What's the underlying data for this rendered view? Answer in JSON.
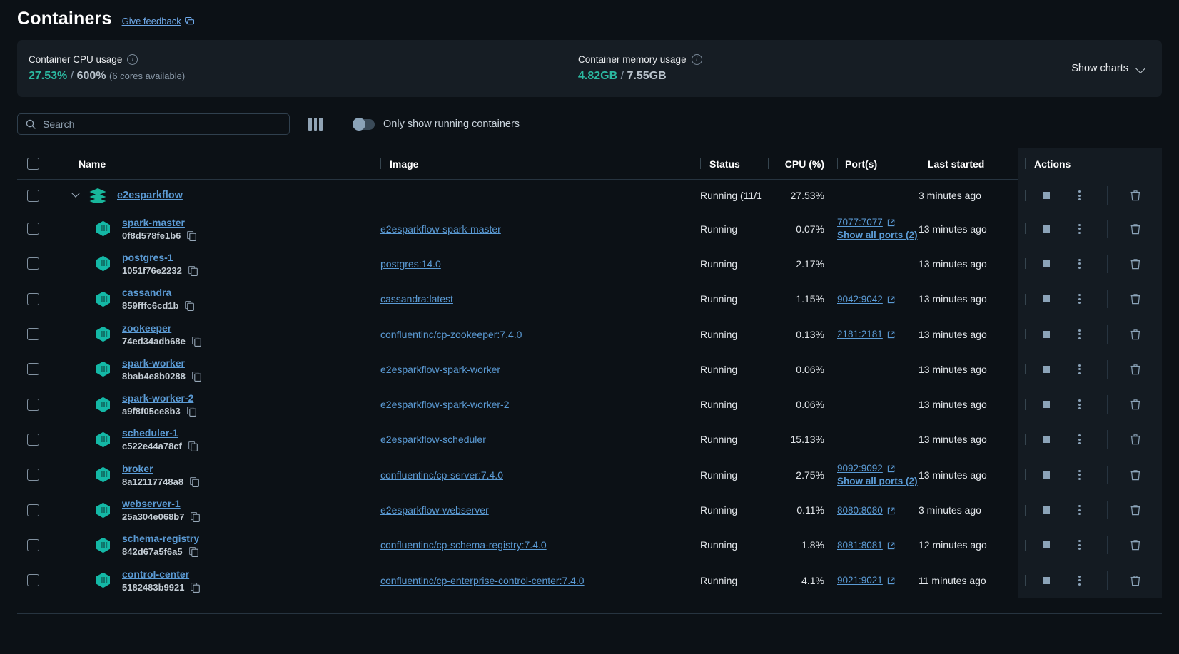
{
  "header": {
    "title": "Containers",
    "feedback_label": "Give feedback",
    "feedback_icon": "comment-icon"
  },
  "stats": {
    "cpu": {
      "label": "Container CPU usage",
      "used": "27.53%",
      "separator": "/",
      "total": "600%",
      "note": "(6 cores available)",
      "info_icon": "info-icon"
    },
    "memory": {
      "label": "Container memory usage",
      "used": "4.82GB",
      "separator": "/",
      "total": "7.55GB",
      "info_icon": "info-icon"
    },
    "show_charts_label": "Show charts",
    "show_charts_icon": "chevron-down-icon",
    "accent_color": "#2bb8a0"
  },
  "toolbar": {
    "search_placeholder": "Search",
    "search_value": "",
    "search_icon": "search-icon",
    "columns_icon": "columns-icon",
    "toggle_label": "Only show running containers",
    "toggle_on": false
  },
  "table": {
    "columns": [
      {
        "key": "name",
        "label": "Name"
      },
      {
        "key": "image",
        "label": "Image"
      },
      {
        "key": "status",
        "label": "Status"
      },
      {
        "key": "cpu",
        "label": "CPU (%)"
      },
      {
        "key": "ports",
        "label": "Port(s)"
      },
      {
        "key": "last_started",
        "label": "Last started"
      },
      {
        "key": "actions",
        "label": "Actions"
      }
    ],
    "group": {
      "name": "e2esparkflow",
      "icon": "stack-icon",
      "expanded": true,
      "status": "Running (11/1",
      "cpu": "27.53%",
      "ports": "",
      "last_started": "3 minutes ago"
    },
    "rows": [
      {
        "name": "spark-master",
        "container_id": "0f8d578fe1b6",
        "image": "e2esparkflow-spark-master",
        "status": "Running",
        "cpu": "0.07%",
        "ports": [
          "7077:7077"
        ],
        "show_all_ports": "Show all ports (2)",
        "last_started": "13 minutes ago"
      },
      {
        "name": "postgres-1",
        "container_id": "1051f76e2232",
        "image": "postgres:14.0",
        "status": "Running",
        "cpu": "2.17%",
        "ports": [],
        "show_all_ports": "",
        "last_started": "13 minutes ago"
      },
      {
        "name": "cassandra",
        "container_id": "859fffc6cd1b",
        "image": "cassandra:latest",
        "status": "Running",
        "cpu": "1.15%",
        "ports": [
          "9042:9042"
        ],
        "show_all_ports": "",
        "last_started": "13 minutes ago"
      },
      {
        "name": "zookeeper",
        "container_id": "74ed34adb68e",
        "image": "confluentinc/cp-zookeeper:7.4.0",
        "status": "Running",
        "cpu": "0.13%",
        "ports": [
          "2181:2181"
        ],
        "show_all_ports": "",
        "last_started": "13 minutes ago"
      },
      {
        "name": "spark-worker",
        "container_id": "8bab4e8b0288",
        "image": "e2esparkflow-spark-worker",
        "status": "Running",
        "cpu": "0.06%",
        "ports": [],
        "show_all_ports": "",
        "last_started": "13 minutes ago"
      },
      {
        "name": "spark-worker-2",
        "container_id": "a9f8f05ce8b3",
        "image": "e2esparkflow-spark-worker-2",
        "status": "Running",
        "cpu": "0.06%",
        "ports": [],
        "show_all_ports": "",
        "last_started": "13 minutes ago"
      },
      {
        "name": "scheduler-1",
        "container_id": "c522e44a78cf",
        "image": "e2esparkflow-scheduler",
        "status": "Running",
        "cpu": "15.13%",
        "ports": [],
        "show_all_ports": "",
        "last_started": "13 minutes ago"
      },
      {
        "name": "broker",
        "container_id": "8a12117748a8",
        "image": "confluentinc/cp-server:7.4.0",
        "status": "Running",
        "cpu": "2.75%",
        "ports": [
          "9092:9092"
        ],
        "show_all_ports": "Show all ports (2)",
        "last_started": "13 minutes ago"
      },
      {
        "name": "webserver-1",
        "container_id": "25a304e068b7",
        "image": "e2esparkflow-webserver",
        "status": "Running",
        "cpu": "0.11%",
        "ports": [
          "8080:8080"
        ],
        "show_all_ports": "",
        "last_started": "3 minutes ago"
      },
      {
        "name": "schema-registry",
        "container_id": "842d67a5f6a5",
        "image": "confluentinc/cp-schema-registry:7.4.0",
        "status": "Running",
        "cpu": "1.8%",
        "ports": [
          "8081:8081"
        ],
        "show_all_ports": "",
        "last_started": "12 minutes ago"
      },
      {
        "name": "control-center",
        "container_id": "5182483b9921",
        "image": "confluentinc/cp-enterprise-control-center:7.4.0",
        "status": "Running",
        "cpu": "4.1%",
        "ports": [
          "9021:9021"
        ],
        "show_all_ports": "",
        "last_started": "11 minutes ago"
      }
    ],
    "row_actions": {
      "stop_icon": "stop-icon",
      "menu_icon": "kebab-menu-icon",
      "delete_icon": "trash-icon"
    }
  }
}
